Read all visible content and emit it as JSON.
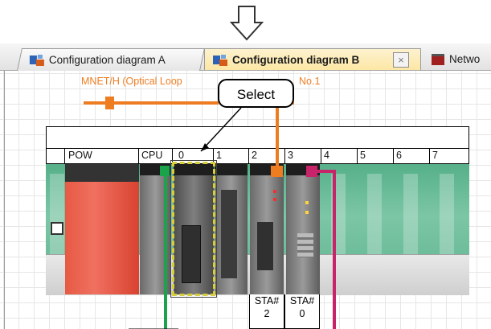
{
  "tabs": [
    {
      "label": "Configuration diagram A",
      "active": false
    },
    {
      "label": "Configuration diagram B",
      "active": true
    },
    {
      "label": "Netwo",
      "active": false
    }
  ],
  "close_glyph": "×",
  "diagram": {
    "network_label": "MNET/H (Optical Loop",
    "network_label_suffix": "No.1",
    "callout": "Select",
    "slots": [
      "POW",
      "CPU",
      "0",
      "1",
      "2",
      "3",
      "4",
      "5",
      "6",
      "7"
    ],
    "stations": [
      "STA#\n2",
      "STA#\n0"
    ]
  },
  "colors": {
    "accent_orange": "#ee7d22",
    "cable_green": "#1aa34a",
    "cable_pink": "#c8246a",
    "selection_yellow": "#d6cf3a"
  },
  "icons": [
    "down-arrow-icon",
    "config-diagram-icon",
    "close-icon",
    "network-icon"
  ]
}
